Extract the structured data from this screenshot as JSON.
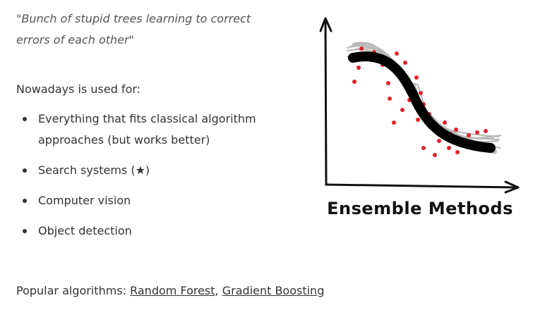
{
  "quote": "\"Bunch of stupid trees learning to correct errors of each other\"",
  "intro": "Nowadays is used for:",
  "uses": [
    "Everything that fits classical algorithm approaches (but works better)",
    "Search systems (★)",
    "Computer vision",
    "Object detection"
  ],
  "popular": {
    "label": "Popular algorithms: ",
    "links": [
      "Random Forest",
      "Gradient Boosting"
    ],
    "separator": ", "
  },
  "figure": {
    "caption": "Ensemble Methods",
    "colors": {
      "axes": "#111111",
      "main_curve": "#000000",
      "weak_curves": "#b8b8b8",
      "points": "#e0202a"
    }
  }
}
